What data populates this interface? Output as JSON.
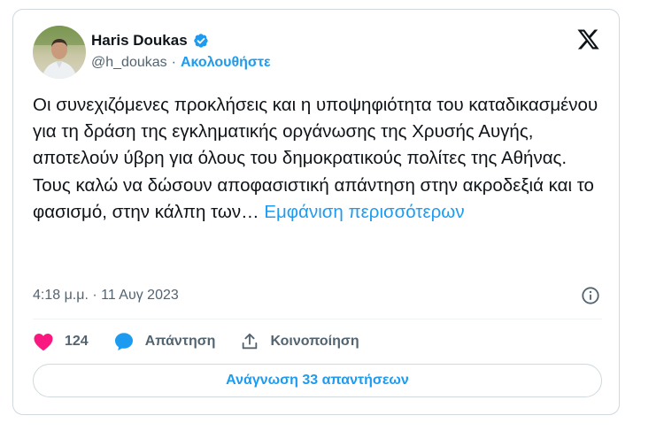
{
  "author": {
    "name": "Haris Doukas",
    "handle": "@h_doukas",
    "separator": "·",
    "follow_label": "Ακολουθήστε",
    "verified": true
  },
  "tweet": {
    "text": "Οι συνεχιζόμενες προκλήσεις και η υποψηφιότητα του καταδικασμένου για τη δράση της εγκληματικής οργάνωσης της Χρυσής Αυγής, αποτελούν ύβρη για όλους του δημοκρατικούς πολίτες της Αθήνας.\nΤους καλώ να δώσουν αποφασιστική απάντηση στην ακροδεξιά και το φασισμό, στην κάλπη των… ",
    "show_more": "Εμφάνιση περισσότερων",
    "timestamp": "4:18 μ.μ. · 11 Αυγ 2023"
  },
  "actions": {
    "like_count": "124",
    "reply_label": "Απάντηση",
    "share_label": "Κοινοποίηση"
  },
  "read_replies_label": "Ανάγνωση 33 απαντήσεων",
  "colors": {
    "accent": "#1d9bf0",
    "like": "#f91880",
    "text": "#0f1419",
    "secondary": "#536471",
    "border": "#cfd9de"
  },
  "icons": {
    "avatar": "avatar",
    "verified": "verified-badge-icon",
    "platform": "x-logo-icon",
    "info": "info-icon",
    "like": "heart-icon",
    "reply": "speech-bubble-icon",
    "share": "share-upload-icon"
  }
}
